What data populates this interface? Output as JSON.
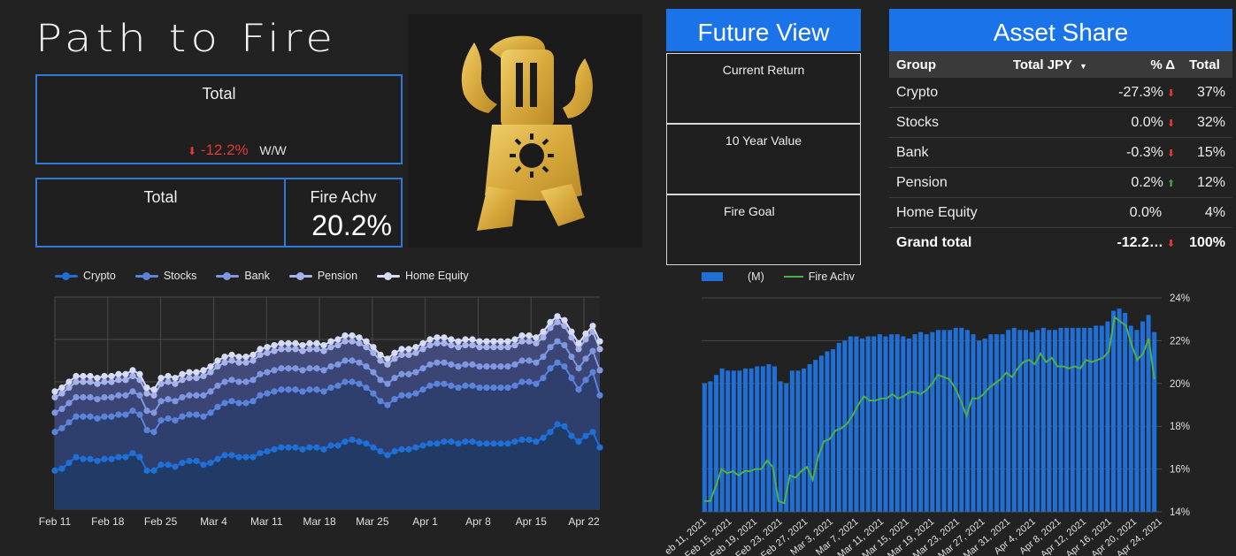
{
  "header": {
    "title": "Path to Fire"
  },
  "total_card": {
    "label": "Total",
    "delta": "-12.2%",
    "delta_unit": "W/W"
  },
  "total_card2": {
    "label": "Total"
  },
  "fire_card": {
    "label": "Fire Achv",
    "value": "20.2%"
  },
  "future_view": {
    "title": "Future View",
    "cards": [
      {
        "label": "Current Return"
      },
      {
        "label": "10 Year Value"
      },
      {
        "label": "Fire Goal"
      }
    ]
  },
  "asset_share": {
    "title": "Asset Share",
    "headers": [
      "Group",
      "Total JPY",
      "% Δ",
      "Total"
    ],
    "rows": [
      {
        "group": "Crypto",
        "pct": "-27.3%",
        "trend": "down",
        "total": "37%"
      },
      {
        "group": "Stocks",
        "pct": "0.0%",
        "trend": "down",
        "total": "32%"
      },
      {
        "group": "Bank",
        "pct": "-0.3%",
        "trend": "down",
        "total": "15%"
      },
      {
        "group": "Pension",
        "pct": "0.2%",
        "trend": "up",
        "total": "12%"
      },
      {
        "group": "Home Equity",
        "pct": "0.0%",
        "trend": "none",
        "total": "4%"
      }
    ],
    "grand": {
      "group": "Grand total",
      "pct": "-12.2…",
      "trend": "down",
      "total": "100%"
    }
  },
  "colors": {
    "accent": "#1a73e8",
    "negative": "#e53935",
    "positive": "#43a047",
    "fire_line": "#4caf50"
  },
  "chart_data": [
    {
      "type": "area",
      "stacked": true,
      "legend_position": "top-left",
      "grid": true,
      "series": [
        {
          "name": "Crypto",
          "color": "#1f6fd6",
          "values": [
            16.0,
            16.1,
            16.4,
            16.7,
            16.6,
            16.6,
            16.5,
            16.6,
            16.6,
            16.7,
            16.7,
            16.9,
            16.7,
            16.0,
            16.0,
            16.3,
            16.3,
            16.2,
            16.4,
            16.5,
            16.5,
            16.3,
            16.4,
            16.6,
            16.8,
            16.8,
            16.7,
            16.7,
            16.7,
            16.9,
            17.0,
            17.1,
            17.2,
            17.2,
            17.2,
            17.1,
            17.2,
            17.2,
            17.1,
            17.3,
            17.3,
            17.5,
            17.6,
            17.5,
            17.4,
            17.2,
            17.0,
            16.8,
            17.0,
            17.1,
            17.1,
            17.2,
            17.3,
            17.4,
            17.4,
            17.5,
            17.5,
            17.4,
            17.5,
            17.5,
            17.4,
            17.4,
            17.4,
            17.4,
            17.4,
            17.5,
            17.6,
            17.6,
            17.5,
            17.7,
            18.0,
            18.4,
            18.3,
            17.8,
            17.5,
            17.8,
            18.0,
            17.2
          ]
        },
        {
          "name": "Stocks",
          "values": [
            18.0,
            18.2,
            18.5,
            18.8,
            18.8,
            18.8,
            18.7,
            18.8,
            18.8,
            18.9,
            18.9,
            19.1,
            18.9,
            18.1,
            18.0,
            18.6,
            18.7,
            18.6,
            18.8,
            18.9,
            18.9,
            18.8,
            19.0,
            19.3,
            19.5,
            19.6,
            19.5,
            19.5,
            19.6,
            19.9,
            20.0,
            20.1,
            20.2,
            20.2,
            20.2,
            20.1,
            20.2,
            20.2,
            20.1,
            20.3,
            20.4,
            20.6,
            20.6,
            20.5,
            20.3,
            20.0,
            19.6,
            19.4,
            19.7,
            19.9,
            19.9,
            20.0,
            20.2,
            20.4,
            20.5,
            20.5,
            20.4,
            20.3,
            20.4,
            20.4,
            20.3,
            20.3,
            20.3,
            20.3,
            20.3,
            20.4,
            20.6,
            20.6,
            20.5,
            20.8,
            21.3,
            21.6,
            21.4,
            20.8,
            20.2,
            20.7,
            21.1,
            19.9
          ]
        },
        {
          "name": "Bank",
          "values": [
            19.0,
            19.2,
            19.5,
            19.8,
            19.8,
            19.8,
            19.7,
            19.8,
            19.8,
            19.9,
            19.9,
            20.1,
            19.9,
            19.1,
            19.0,
            19.6,
            19.7,
            19.6,
            19.8,
            19.9,
            19.9,
            19.9,
            20.1,
            20.4,
            20.6,
            20.7,
            20.6,
            20.6,
            20.7,
            21.0,
            21.1,
            21.2,
            21.3,
            21.3,
            21.3,
            21.2,
            21.3,
            21.3,
            21.2,
            21.4,
            21.5,
            21.7,
            21.7,
            21.6,
            21.4,
            21.1,
            20.7,
            20.5,
            20.8,
            21.0,
            21.0,
            21.1,
            21.3,
            21.5,
            21.6,
            21.6,
            21.5,
            21.4,
            21.5,
            21.5,
            21.4,
            21.4,
            21.4,
            21.4,
            21.4,
            21.5,
            21.7,
            21.7,
            21.6,
            21.9,
            22.4,
            22.7,
            22.5,
            21.9,
            21.3,
            21.8,
            22.2,
            21.2
          ]
        },
        {
          "name": "Pension",
          "values": [
            19.8,
            20.0,
            20.3,
            20.6,
            20.6,
            20.6,
            20.5,
            20.6,
            20.6,
            20.7,
            20.7,
            20.9,
            20.7,
            20.0,
            19.9,
            20.5,
            20.6,
            20.5,
            20.7,
            20.8,
            20.8,
            20.9,
            21.1,
            21.4,
            21.6,
            21.7,
            21.6,
            21.6,
            21.7,
            22.0,
            22.1,
            22.2,
            22.3,
            22.3,
            22.3,
            22.2,
            22.3,
            22.3,
            22.2,
            22.4,
            22.5,
            22.7,
            22.7,
            22.6,
            22.4,
            22.1,
            21.7,
            21.5,
            21.8,
            22.0,
            22.0,
            22.1,
            22.3,
            22.5,
            22.6,
            22.6,
            22.5,
            22.4,
            22.5,
            22.5,
            22.4,
            22.4,
            22.4,
            22.4,
            22.4,
            22.5,
            22.7,
            22.7,
            22.6,
            22.9,
            23.4,
            23.7,
            23.5,
            22.9,
            22.3,
            22.8,
            23.2,
            22.3
          ]
        },
        {
          "name": "Home Equity",
          "values": [
            20.1,
            20.3,
            20.6,
            20.9,
            20.9,
            20.9,
            20.8,
            20.9,
            20.9,
            21.0,
            21.0,
            21.2,
            21.0,
            20.3,
            20.2,
            20.8,
            20.9,
            20.8,
            21.0,
            21.1,
            21.1,
            21.2,
            21.4,
            21.7,
            21.9,
            22.0,
            21.9,
            21.9,
            22.0,
            22.3,
            22.4,
            22.5,
            22.6,
            22.6,
            22.6,
            22.5,
            22.6,
            22.6,
            22.5,
            22.7,
            22.8,
            23.0,
            23.0,
            22.9,
            22.7,
            22.4,
            22.0,
            21.8,
            22.1,
            22.3,
            22.3,
            22.4,
            22.6,
            22.8,
            22.9,
            22.9,
            22.8,
            22.7,
            22.8,
            22.8,
            22.7,
            22.7,
            22.7,
            22.7,
            22.7,
            22.8,
            23.0,
            23.0,
            22.9,
            23.2,
            23.7,
            24.0,
            23.8,
            23.2,
            22.6,
            23.1,
            23.5,
            22.7
          ]
        }
      ],
      "x_labels": [
        "Feb 11",
        "Feb 18",
        "Feb 25",
        "Mar 4",
        "Mar 11",
        "Mar 18",
        "Mar 25",
        "Apr 1",
        "Apr 8",
        "Apr 15",
        "Apr 22"
      ],
      "y_range": [
        14,
        25
      ]
    },
    {
      "type": "bar+line",
      "legend_position": "top-left",
      "grid": true,
      "bar_legend": "(M)",
      "line_legend": "Fire Achv",
      "bar_series": {
        "name": "(M)",
        "values": [
          20.0,
          20.1,
          20.4,
          20.7,
          20.6,
          20.6,
          20.6,
          20.7,
          20.7,
          20.8,
          20.8,
          20.9,
          20.8,
          20.1,
          20.0,
          20.6,
          20.6,
          20.7,
          20.9,
          21.1,
          21.3,
          21.5,
          21.6,
          21.9,
          22.0,
          22.2,
          22.2,
          22.1,
          22.2,
          22.2,
          22.3,
          22.2,
          22.3,
          22.3,
          22.2,
          22.1,
          22.3,
          22.4,
          22.3,
          22.4,
          22.5,
          22.5,
          22.5,
          22.6,
          22.6,
          22.5,
          22.3,
          22.0,
          22.1,
          22.3,
          22.3,
          22.3,
          22.5,
          22.6,
          22.5,
          22.5,
          22.4,
          22.5,
          22.6,
          22.5,
          22.5,
          22.6,
          22.6,
          22.6,
          22.6,
          22.6,
          22.6,
          22.7,
          22.7,
          22.9,
          23.4,
          23.5,
          23.3,
          22.7,
          22.5,
          22.9,
          23.2,
          22.4
        ]
      },
      "line_series": {
        "name": "Fire Achv",
        "values": [
          14.5,
          14.5,
          15.2,
          16.0,
          15.8,
          15.9,
          15.7,
          15.9,
          15.9,
          16.0,
          16.0,
          16.4,
          16.1,
          14.5,
          14.4,
          15.7,
          15.6,
          15.9,
          16.1,
          15.5,
          16.6,
          17.3,
          17.4,
          17.8,
          17.9,
          18.1,
          18.5,
          19.0,
          19.4,
          19.2,
          19.2,
          19.3,
          19.3,
          19.5,
          19.3,
          19.4,
          19.6,
          19.6,
          19.5,
          19.7,
          20.0,
          20.4,
          20.3,
          20.2,
          19.8,
          19.2,
          18.5,
          19.3,
          19.3,
          19.5,
          19.8,
          20.0,
          20.2,
          20.5,
          20.3,
          20.7,
          21.0,
          21.1,
          20.9,
          21.4,
          21.0,
          21.2,
          20.8,
          20.8,
          20.7,
          20.8,
          20.7,
          21.1,
          21.0,
          21.1,
          21.2,
          21.5,
          23.1,
          22.9,
          22.7,
          21.8,
          21.1,
          21.4,
          22.1,
          20.2
        ]
      },
      "x_labels": [
        "eb 11, 2021",
        "Feb 15, 2021",
        "Feb 19, 2021",
        "Feb 23, 2021",
        "Feb 27, 2021",
        "Mar 3, 2021",
        "Mar 7, 2021",
        "Mar 11, 2021",
        "Mar 15, 2021",
        "Mar 19, 2021",
        "Mar 23, 2021",
        "Mar 27, 2021",
        "Mar 31, 2021",
        "Apr 4, 2021",
        "Apr 8, 2021",
        "Apr 12, 2021",
        "Apr 16, 2021",
        "Apr 20, 2021",
        "Apr 24, 2021"
      ],
      "y_ticks": [
        "14%",
        "16%",
        "18%",
        "20%",
        "22%",
        "24%"
      ],
      "y_range": [
        14,
        24
      ]
    }
  ]
}
